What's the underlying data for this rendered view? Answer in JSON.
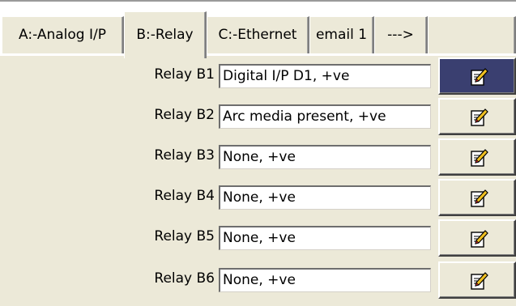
{
  "tabs": [
    {
      "label": "A:-Analog I/P"
    },
    {
      "label": "B:-Relay"
    },
    {
      "label": "C:-Ethernet"
    },
    {
      "label": "email 1"
    },
    {
      "label": "--->"
    },
    {
      "label": ""
    }
  ],
  "active_tab": "B:-Relay",
  "relays": [
    {
      "label": "Relay B1",
      "value": "Digital I/P D1, +ve",
      "button_icon": "edit-icon",
      "selected": true
    },
    {
      "label": "Relay B2",
      "value": "Arc media present, +ve",
      "button_icon": "edit-icon",
      "selected": false
    },
    {
      "label": "Relay B3",
      "value": "None, +ve",
      "button_icon": "edit-icon",
      "selected": false
    },
    {
      "label": "Relay B4",
      "value": "None, +ve",
      "button_icon": "edit-icon",
      "selected": false
    },
    {
      "label": "Relay B5",
      "value": "None, +ve",
      "button_icon": "edit-icon",
      "selected": false
    },
    {
      "label": "Relay B6",
      "value": "None, +ve",
      "button_icon": "edit-icon",
      "selected": false
    }
  ],
  "colors": {
    "panel_background": "#ece9d8",
    "selected_button": "#3a3f70"
  }
}
